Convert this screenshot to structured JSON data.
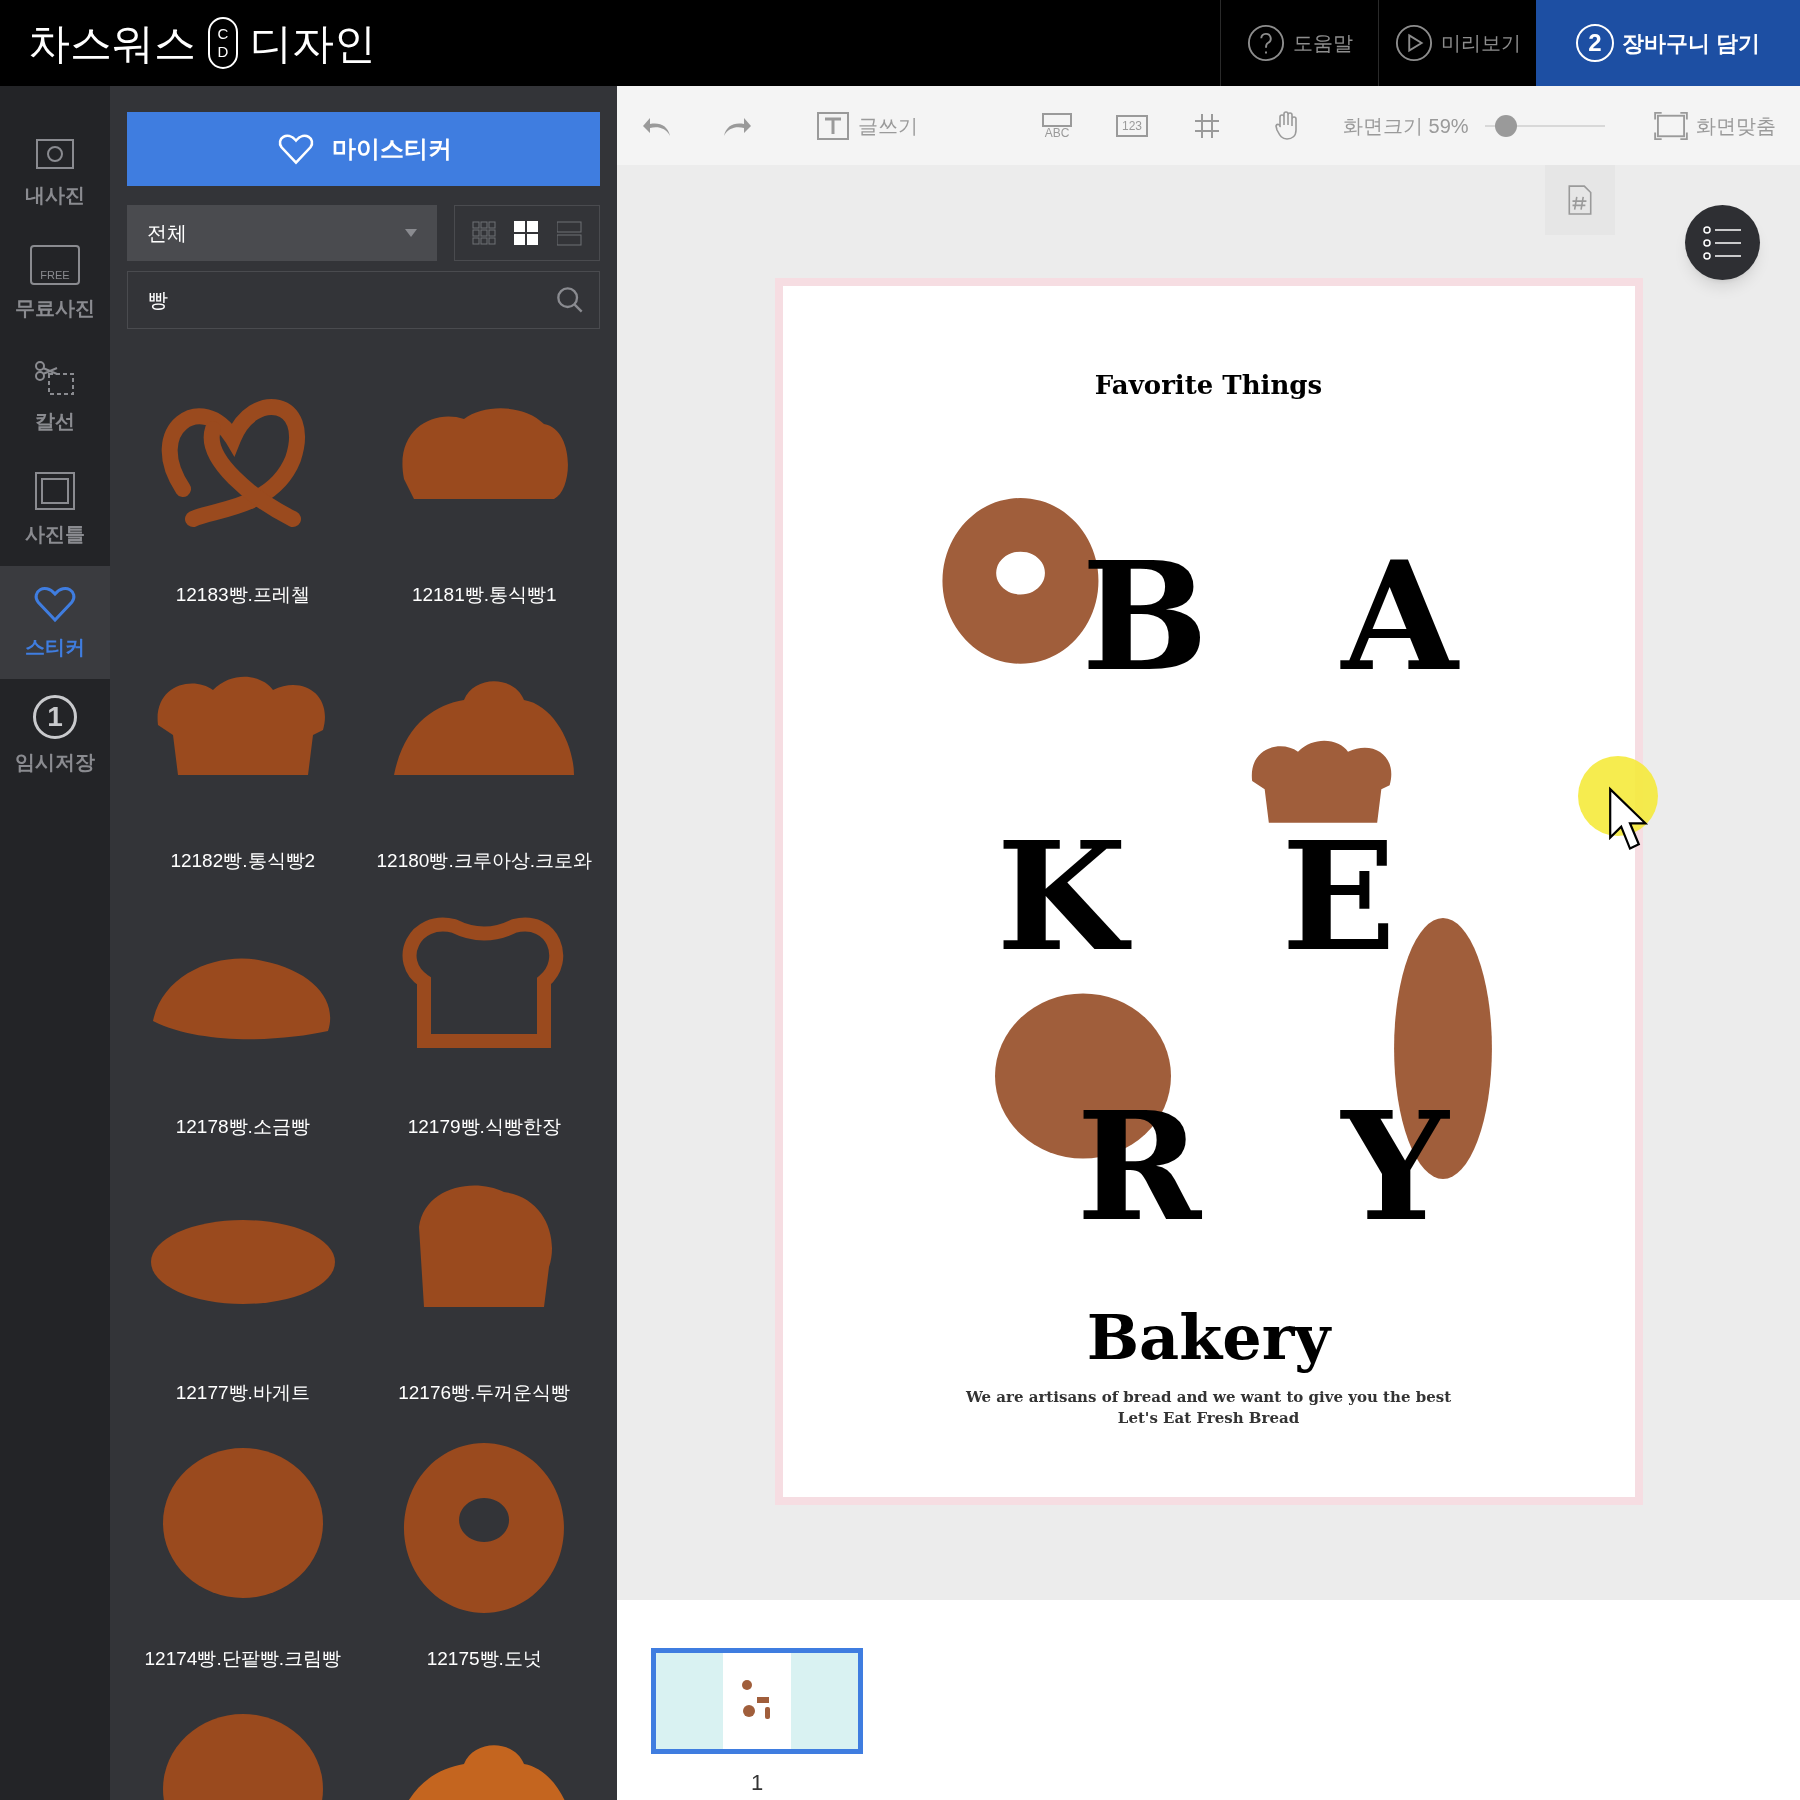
{
  "header": {
    "logo_text": "차스워스",
    "logo_badge": [
      "C",
      "D"
    ],
    "logo_suffix": "디자인",
    "buttons": [
      {
        "kind": "help",
        "label": "도움말"
      },
      {
        "kind": "preview",
        "label": "미리보기"
      },
      {
        "kind": "cart",
        "step": "2",
        "label": "장바구니 담기"
      }
    ]
  },
  "rail": [
    {
      "kind": "photo",
      "label": "내사진",
      "selected": false
    },
    {
      "kind": "free",
      "label": "무료사진",
      "badge": "FREE",
      "selected": false
    },
    {
      "kind": "cut",
      "label": "칼선",
      "selected": false
    },
    {
      "kind": "frame",
      "label": "사진틀",
      "selected": false
    },
    {
      "kind": "sticker",
      "label": "스티커",
      "selected": true
    },
    {
      "kind": "save",
      "step": "1",
      "label": "임시저장",
      "selected": false
    }
  ],
  "panel": {
    "my_sticker_button": "마이스티커",
    "category": {
      "value": "전체"
    },
    "view_modes": [
      {
        "kind": "small",
        "selected": false
      },
      {
        "kind": "large",
        "selected": true
      },
      {
        "kind": "list",
        "selected": false
      }
    ],
    "search": {
      "value": "빵"
    },
    "stickers": [
      {
        "kind": "pretzel",
        "label": "12183빵.프레첼"
      },
      {
        "kind": "loaf",
        "label": "12181빵.통식빵1"
      },
      {
        "kind": "loaf2",
        "label": "12182빵.통식빵2"
      },
      {
        "kind": "croissant",
        "label": "12180빵.크루아상.크로와"
      },
      {
        "kind": "salt",
        "label": "12178빵.소금빵"
      },
      {
        "kind": "slice",
        "label": "12179빵.식빵한장"
      },
      {
        "kind": "baguette",
        "label": "12177빵.바게트"
      },
      {
        "kind": "thick",
        "label": "12176빵.두꺼운식빵"
      },
      {
        "kind": "cream",
        "label": "12174빵.단팥빵.크림빵"
      },
      {
        "kind": "donut",
        "label": "12175빵.도넛"
      }
    ]
  },
  "toolbar": {
    "write_label": "글쓰기",
    "abc_label": "ABC",
    "number_label": "123",
    "zoom_label": "화면크기 59%",
    "zoom_slider": {
      "level": 0.18
    },
    "fit_label": "화면맞춤"
  },
  "design": {
    "title": "Favorite Things",
    "letters": [
      "B",
      "A",
      "K",
      "E",
      "R",
      "Y"
    ],
    "heading": "Bakery",
    "tagline": "We are artisans of bread and we want to give you the best",
    "subline": "Let's Eat Fresh Bread"
  },
  "pages": [
    {
      "number": "1",
      "selected": true
    }
  ]
}
